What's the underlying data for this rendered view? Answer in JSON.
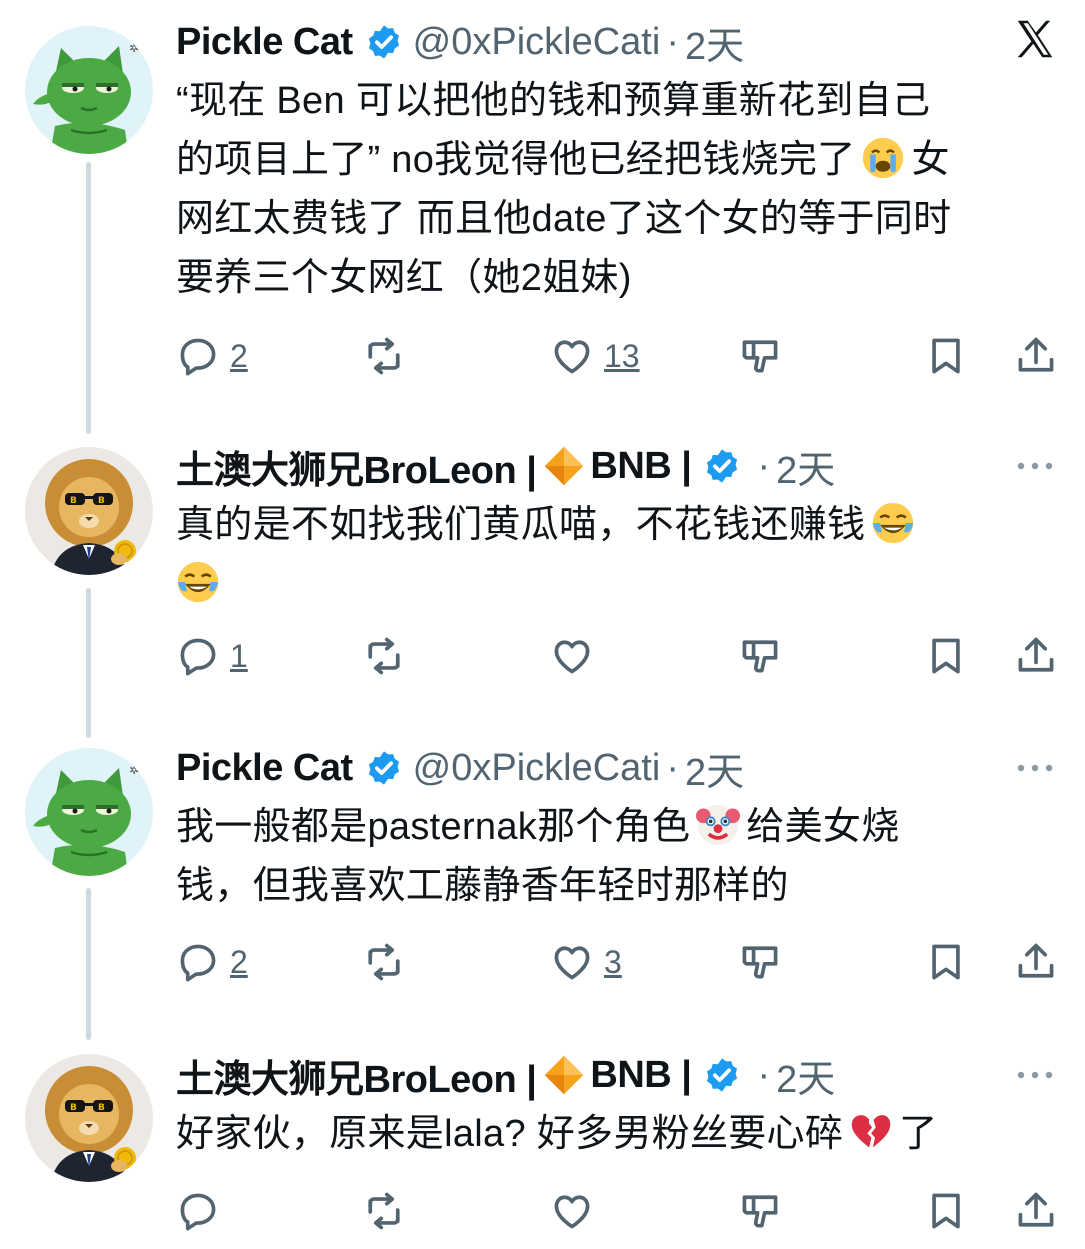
{
  "tweets": [
    {
      "author": "Pickle Cat",
      "handle": "@0xPickleCati",
      "separator": "·",
      "time": "2天",
      "text_lines": [
        "“现在 Ben 可以把他的钱和预算重新花到自己",
        "的项目上了” no我觉得他已经把钱烧完了",
        "网红太费钱了 而且他date了这个女的等于同时",
        "要养三个女网红（她2姐妹)"
      ],
      "line2_tail": "女",
      "emoji": "loudly-crying-face",
      "replies": "2",
      "likes": "13",
      "avatar": "pickle-cat-avatar"
    },
    {
      "author": "土澳大狮兄BroLeon |",
      "author_tail": "BNB |",
      "separator": "·",
      "time": "2天",
      "text_lines": [
        "真的是不如找我们黄瓜喵，不花钱还赚钱"
      ],
      "emoji": "face-with-tears-of-joy",
      "replies": "1",
      "avatar": "lion-avatar"
    },
    {
      "author": "Pickle Cat",
      "handle": "@0xPickleCati",
      "separator": "·",
      "time": "2天",
      "text_lines": [
        "我一般都是pasternak那个角色",
        "给美女烧",
        "钱，但我喜欢工藤静香年轻时那样的"
      ],
      "emoji": "clown-face",
      "replies": "2",
      "likes": "3",
      "avatar": "pickle-cat-avatar"
    },
    {
      "author": "土澳大狮兄BroLeon |",
      "author_tail": "BNB |",
      "separator": "·",
      "time": "2天",
      "text_lines": [
        "好家伙，原来是lala? 好多男粉丝要心碎",
        "了"
      ],
      "emoji": "broken-heart",
      "avatar": "lion-avatar"
    }
  ],
  "colors": {
    "text": "#0f1419",
    "secondary": "#536471",
    "verified": "#1d9bf0",
    "thread_line": "#cfd9de",
    "bnb": "#f0b90b"
  },
  "icons": {
    "reply": "reply-icon",
    "retweet": "retweet-icon",
    "like": "heart-icon",
    "dislike": "dislike-icon",
    "bookmark": "bookmark-icon",
    "share": "share-icon",
    "more": "more-icon",
    "logo": "x-logo-icon"
  }
}
